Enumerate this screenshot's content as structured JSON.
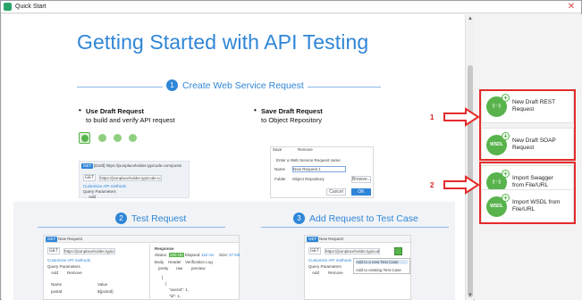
{
  "window": {
    "title": "Quick Start"
  },
  "page": {
    "title": "Getting Started with API Testing"
  },
  "steps": [
    {
      "number": "1",
      "title": "Create Web Service Request"
    },
    {
      "number": "2",
      "title": "Test Request"
    },
    {
      "number": "3",
      "title": "Add Request to Test Case"
    }
  ],
  "step1": {
    "use_draft": {
      "title": "Use Draft Request",
      "subtitle": "to build and verify API request"
    },
    "save_draft": {
      "title": "Save Draft Request",
      "subtitle": "to Object Repository"
    }
  },
  "sidebar": {
    "actions": [
      {
        "label": "New Draft REST Request",
        "icon": "rest-request-icon"
      },
      {
        "label": "New Draft SOAP Request",
        "icon": "soap-request-icon"
      },
      {
        "label": "Import Swagger from File/URL",
        "icon": "swagger-icon"
      },
      {
        "label": "Import WSDL from File/URL",
        "icon": "wsdl-icon"
      }
    ]
  },
  "annotations": {
    "one": "1",
    "two": "2"
  },
  "mock_texts": {
    "get": "GET",
    "new_request": "New Request",
    "new_request_1": "New Request 1",
    "save": "Save",
    "remove": "Remove",
    "cancel": "Cancel",
    "ok": "OK",
    "browse": "Browse...",
    "name": "Name",
    "folder": "Folder",
    "object_repository": "Object Repository",
    "enter_ws_name": "Enter a Web Service Request name",
    "query_params": "Query Parameters",
    "add": "Add",
    "response": "Response",
    "status": "Status:",
    "status_code": "200 OK",
    "elapsed": "Elapsed:",
    "elapsed_value": "115 ms",
    "size": "Size:",
    "size_value": "37 KB",
    "body": "Body",
    "header": "Header",
    "verification_log": "Verification Log",
    "pretty": "pretty",
    "raw": "raw",
    "preview": "preview",
    "add_to_new_test_case": "Add to a new Test Case",
    "add_to_existing_test_case": "Add to existing Test Case",
    "url": "https://jsonplaceholder.typicode.com/posts",
    "draft_url": "[Draft] https://jsonplaceholder.typicode.com/posts",
    "customize_api_methods": "Customize API methods",
    "col_name": "Name",
    "col_value": "Value",
    "row_name": "postId",
    "row_value": "${postId}",
    "json_open": "[",
    "json_brace": "{",
    "json_user": "\"userId\": 1,",
    "json_id": "\"id\": 1,"
  }
}
